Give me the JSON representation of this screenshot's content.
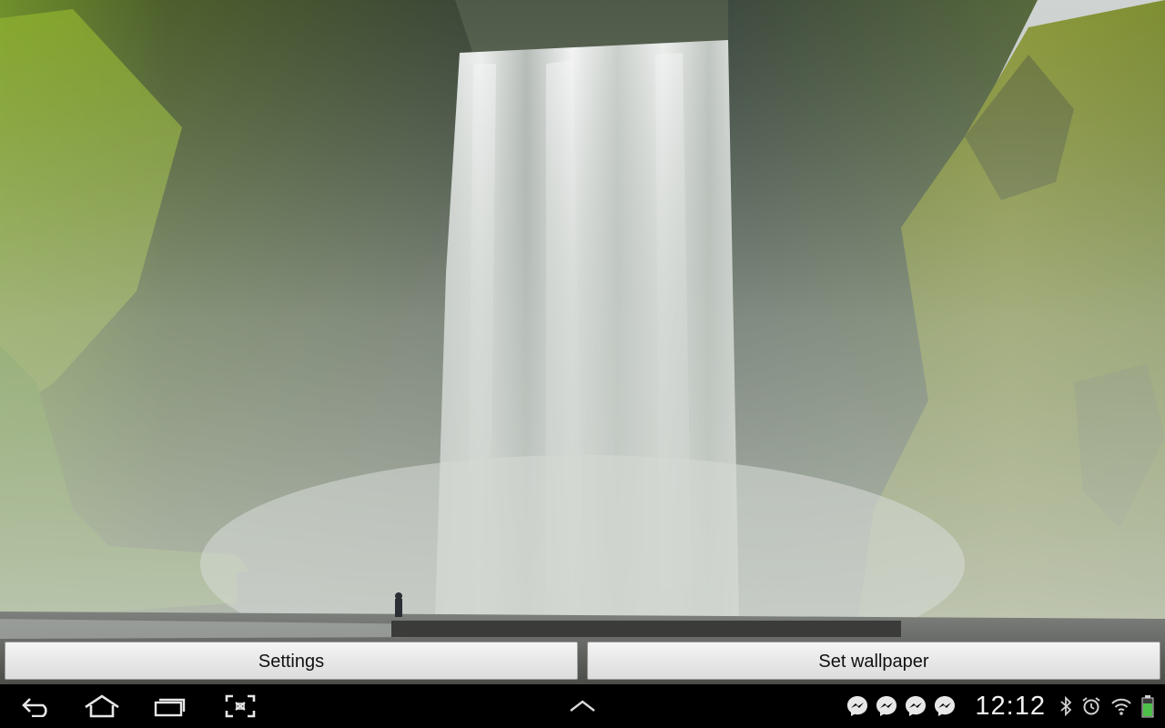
{
  "wallpaper": {
    "subject": "waterfall-scene"
  },
  "actions": {
    "settings_label": "Settings",
    "set_wallpaper_label": "Set wallpaper"
  },
  "navigation": {
    "back": "back-icon",
    "home": "home-icon",
    "recents": "recent-apps-icon",
    "screenshot": "screenshot-icon",
    "menu_up": "chevron-up-icon"
  },
  "status": {
    "time": "12:12",
    "notifications": [
      "messenger-icon",
      "messenger-icon",
      "messenger-icon",
      "messenger-icon"
    ],
    "indicators": [
      "bluetooth-icon",
      "alarm-icon",
      "wifi-icon",
      "battery-icon"
    ],
    "battery_level": 0.7
  },
  "colors": {
    "system_bar": "#000000",
    "battery_fill": "#4ec04a",
    "button_face": "#e8e8e8"
  }
}
